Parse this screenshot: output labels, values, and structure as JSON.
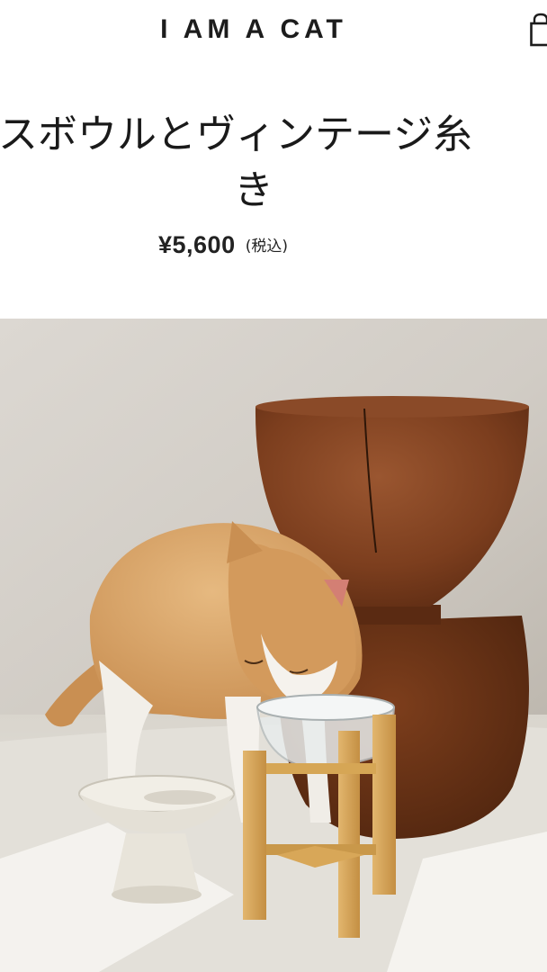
{
  "header": {
    "brand": "I AM A CAT",
    "cart_icon": "shopping-bag-icon"
  },
  "product": {
    "title_line1": "スボウルとヴィンテージ糸",
    "title_line2": "き",
    "price": "¥5,600",
    "tax_note": "(税込)"
  },
  "photo": {
    "subject": "cat-drinking-from-glass-bowl-photo"
  },
  "colors": {
    "text": "#1a1a1a",
    "background": "#ffffff"
  }
}
